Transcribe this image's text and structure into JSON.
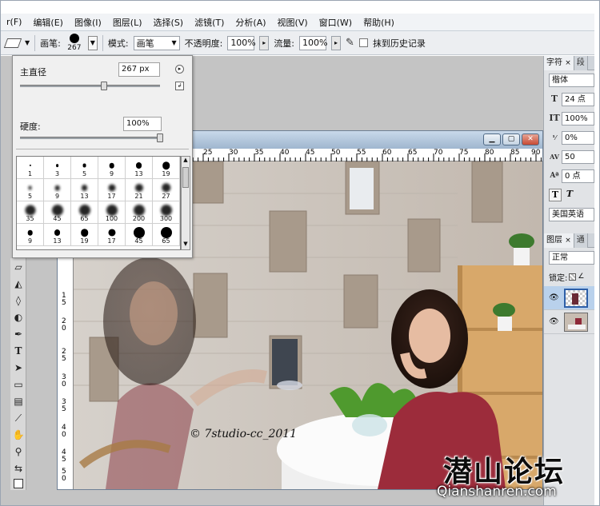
{
  "menu": [
    "r(F)",
    "编辑(E)",
    "图像(I)",
    "图层(L)",
    "选择(S)",
    "滤镜(T)",
    "分析(A)",
    "视图(V)",
    "窗口(W)",
    "帮助(H)"
  ],
  "options": {
    "brush_label": "画笔:",
    "brush_size": "267",
    "mode_label": "模式:",
    "mode_value": "画笔",
    "opacity_label": "不透明度:",
    "opacity_value": "100%",
    "flow_label": "流量:",
    "flow_value": "100%",
    "erase_history_label": "抹到历史记录"
  },
  "brush_panel": {
    "diameter_label": "主直径",
    "diameter_value": "267 px",
    "hardness_label": "硬度:",
    "hardness_value": "100%",
    "diameter_level": 0.6,
    "hardness_level": 1.0,
    "presets": [
      "1",
      "3",
      "5",
      "9",
      "13",
      "19",
      "5",
      "9",
      "13",
      "17",
      "21",
      "27",
      "35",
      "45",
      "65",
      "100",
      "200",
      "300",
      "9",
      "13",
      "19",
      "17",
      "45",
      "65"
    ]
  },
  "document": {
    "ruler_h": [
      "25",
      "30",
      "35",
      "40",
      "45",
      "50",
      "55",
      "60",
      "65",
      "70",
      "75",
      "80",
      "85",
      "90"
    ],
    "ruler_v": [
      "1",
      "5",
      "2",
      "0",
      "2",
      "5",
      "3",
      "0",
      "3",
      "5",
      "4",
      "0",
      "4",
      "5",
      "5",
      "0",
      "5",
      "5"
    ],
    "copyright": "© 7studio-cc_2011"
  },
  "character_panel": {
    "tabs": [
      "字符",
      "段"
    ],
    "font": "楷体",
    "size": "24 点",
    "leading": "100%",
    "baseline": "0%",
    "tracking": "50",
    "shift": "0 点",
    "language": "美国英语"
  },
  "layers_panel": {
    "tabs": [
      "图层",
      "通"
    ],
    "blend_mode": "正常",
    "lock_label": "锁定:"
  },
  "watermark": {
    "chinese": "潜山论坛",
    "url": "Qianshanren.com"
  }
}
